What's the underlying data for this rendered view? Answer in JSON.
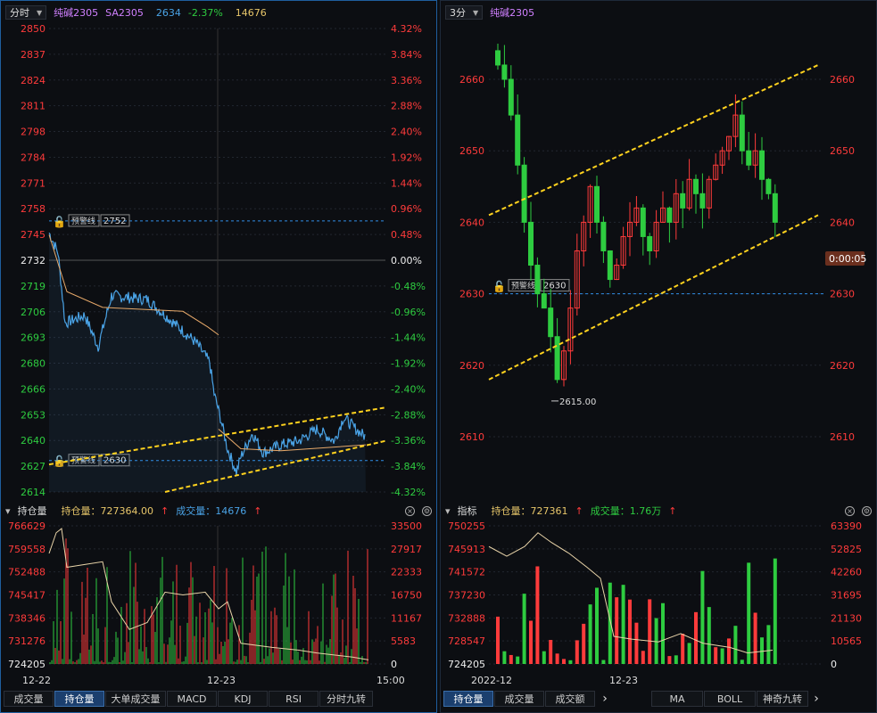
{
  "colors": {
    "up": "#ff3b3b",
    "down": "#2ecc40",
    "price": "#4aa3e6",
    "avg": "#e7a96a",
    "trend": "#ffd21e",
    "alert": "#2f8de6",
    "bg": "#0c0e12",
    "grid": "#222730"
  },
  "left": {
    "period": "分时",
    "symbol_cn": "纯碱2305",
    "symbol": "SA2305",
    "last": "2634",
    "change": "-2.37%",
    "volume": "14676",
    "price_axis": [
      "2850",
      "2837",
      "2824",
      "2811",
      "2798",
      "2784",
      "2771",
      "2758",
      "2745",
      "2732",
      "2719",
      "2706",
      "2693",
      "2680",
      "2666",
      "2653",
      "2640",
      "2627",
      "2614"
    ],
    "pct_axis": [
      "4.32%",
      "3.84%",
      "3.36%",
      "2.88%",
      "2.40%",
      "1.92%",
      "1.44%",
      "0.96%",
      "0.48%",
      "0.00%",
      "-0.48%",
      "-0.96%",
      "-1.44%",
      "-1.92%",
      "-2.40%",
      "-2.88%",
      "-3.36%",
      "-3.84%",
      "-4.32%"
    ],
    "alert1": {
      "label": "预警线",
      "value": "2752"
    },
    "alert2": {
      "label": "预警线",
      "value": "2630"
    },
    "sub_header": {
      "name": "持仓量",
      "oi_label": "持仓量：727364.00",
      "vol_label": "成交量：14676"
    },
    "oi_axis": [
      "766629",
      "759558",
      "752488",
      "745417",
      "738346",
      "731276",
      "724205"
    ],
    "vol_axis": [
      "33500",
      "27917",
      "22333",
      "16750",
      "11167",
      "5583",
      "0"
    ],
    "x_labels": [
      "12-22",
      "12-23",
      "15:00"
    ],
    "tabs": [
      "成交量",
      "持仓量",
      "大单成交量",
      "MACD",
      "KDJ",
      "RSI",
      "分时九转"
    ],
    "active_tab": 1
  },
  "right": {
    "period": "3分",
    "symbol_cn": "纯碱2305",
    "price_axis": [
      "2660",
      "2650",
      "2640",
      "2630",
      "2620",
      "2610"
    ],
    "alert": {
      "label": "预警线",
      "value": "2630"
    },
    "low_label": "2615.00",
    "countdown": "0:00:05",
    "sub_header": {
      "name": "指标",
      "oi_label": "持仓量：727361",
      "vol_label": "成交量：1.76万"
    },
    "oi_axis": [
      "750255",
      "745913",
      "741572",
      "737230",
      "732888",
      "728547",
      "724205"
    ],
    "vol_axis": [
      "63390",
      "52825",
      "42260",
      "31695",
      "21130",
      "10565",
      "0"
    ],
    "x_labels": [
      "2022-12",
      "12-23"
    ],
    "tabs": [
      "持仓量",
      "成交量",
      "成交额"
    ],
    "tabs2": [
      "MA",
      "BOLL",
      "神奇九转"
    ],
    "active_tab": 0
  }
}
